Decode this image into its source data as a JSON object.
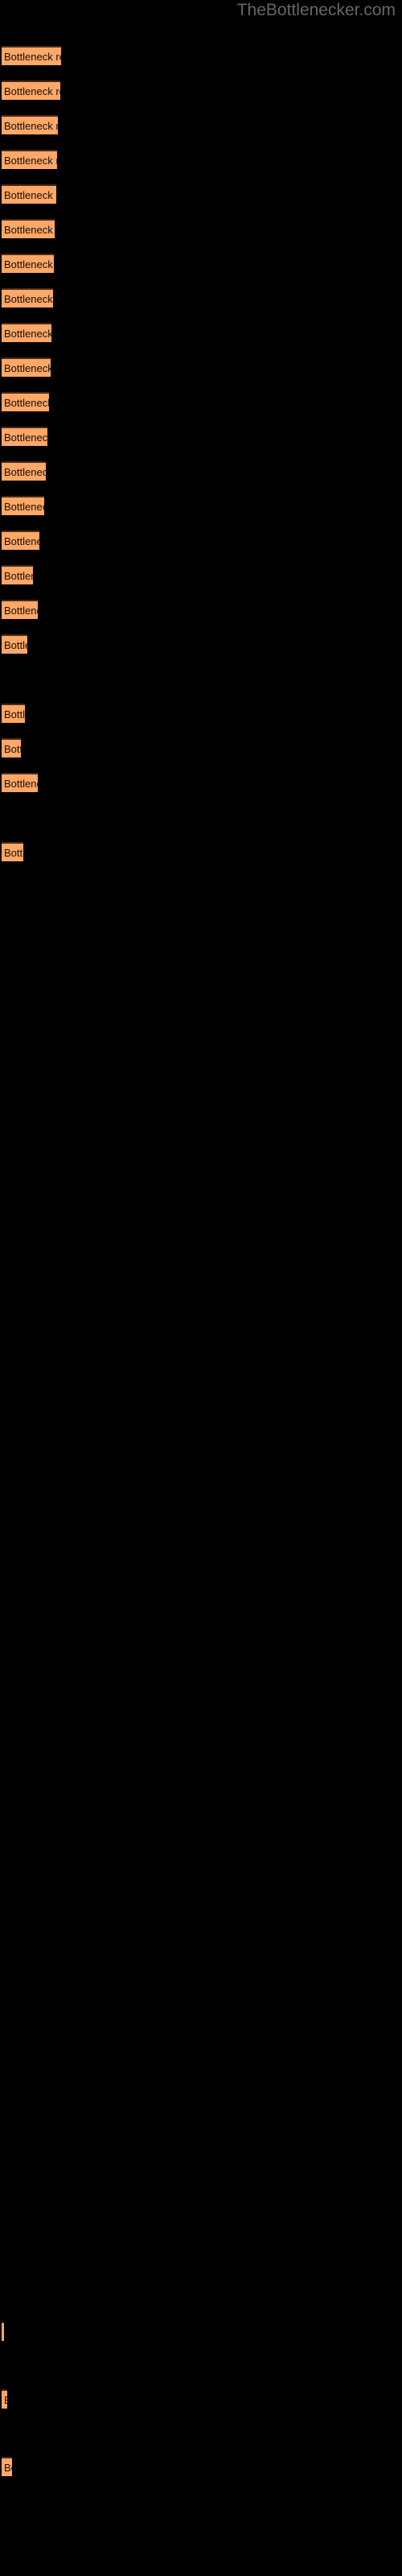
{
  "site": {
    "watermark": "TheBottlenecker.com"
  },
  "chart_data": {
    "type": "bar",
    "orientation": "horizontal",
    "title": "",
    "subtitle": "",
    "xlabel": "",
    "ylabel": "",
    "grid": false,
    "legend": null,
    "axis_visible": false,
    "background_color": "#000000",
    "bar_color": "#ffa766",
    "bar_border_color": "#4a2a16",
    "label_color": "#111111",
    "watermark_color": "#666666",
    "bar_label_text": "Bottleneck result",
    "xlim": [
      0,
      74
    ],
    "categories": [
      "bar-1",
      "bar-2",
      "bar-3",
      "bar-4",
      "bar-5",
      "bar-6",
      "bar-7",
      "bar-8",
      "bar-9",
      "bar-10",
      "bar-11",
      "bar-12",
      "bar-13",
      "bar-14",
      "bar-15",
      "bar-16",
      "bar-17",
      "bar-18",
      "bar-19",
      "bar-20",
      "bar-21",
      "bar-22",
      "bar-23",
      "bar-24",
      "bar-25",
      "bar-26",
      "bar-27",
      "bar-28",
      "bar-29",
      "bar-30",
      "bar-31",
      "bar-32",
      "bar-33",
      "bar-34",
      "bar-35"
    ],
    "values": [
      74,
      73,
      70,
      69,
      68,
      66,
      65,
      64,
      62,
      61,
      59,
      57,
      55,
      53,
      47,
      39,
      45,
      32,
      0,
      29,
      24,
      45,
      0,
      27,
      0,
      0,
      0,
      0,
      0,
      0,
      0,
      0,
      3,
      7,
      13
    ],
    "bars": [
      {
        "name": "bar-1",
        "y": 57,
        "width": 74,
        "label": "Bottleneck result"
      },
      {
        "name": "bar-2",
        "y": 100,
        "width": 73,
        "label": "Bottleneck result"
      },
      {
        "name": "bar-3",
        "y": 143,
        "width": 70,
        "label": "Bottleneck result"
      },
      {
        "name": "bar-4",
        "y": 186,
        "width": 69,
        "label": "Bottleneck result"
      },
      {
        "name": "bar-5",
        "y": 229,
        "width": 68,
        "label": "Bottleneck result"
      },
      {
        "name": "bar-6",
        "y": 272,
        "width": 66,
        "label": "Bottleneck result"
      },
      {
        "name": "bar-7",
        "y": 315,
        "width": 65,
        "label": "Bottleneck result"
      },
      {
        "name": "bar-8",
        "y": 358,
        "width": 64,
        "label": "Bottleneck result"
      },
      {
        "name": "bar-9",
        "y": 401,
        "width": 62,
        "label": "Bottleneck result"
      },
      {
        "name": "bar-10",
        "y": 444,
        "width": 61,
        "label": "Bottleneck result"
      },
      {
        "name": "bar-11",
        "y": 487,
        "width": 59,
        "label": "Bottleneck result"
      },
      {
        "name": "bar-12",
        "y": 530,
        "width": 57,
        "label": "Bottleneck result"
      },
      {
        "name": "bar-13",
        "y": 573,
        "width": 55,
        "label": "Bottleneck result"
      },
      {
        "name": "bar-14",
        "y": 616,
        "width": 53,
        "label": "Bottleneck result"
      },
      {
        "name": "bar-15",
        "y": 659,
        "width": 47,
        "label": "Bottleneck result"
      },
      {
        "name": "bar-16",
        "y": 702,
        "width": 39,
        "label": "Bottleneck result"
      },
      {
        "name": "bar-17",
        "y": 745,
        "width": 45,
        "label": "Bottleneck result"
      },
      {
        "name": "bar-18",
        "y": 788,
        "width": 32,
        "label": "Bottleneck result"
      },
      {
        "name": "bar-19",
        "y": 831,
        "width": 0,
        "label": "Bottleneck result"
      },
      {
        "name": "bar-20",
        "y": 874,
        "width": 29,
        "label": "Bottleneck result"
      },
      {
        "name": "bar-21",
        "y": 917,
        "width": 24,
        "label": "Bottleneck result"
      },
      {
        "name": "bar-22",
        "y": 960,
        "width": 45,
        "label": "Bottleneck result"
      },
      {
        "name": "bar-23",
        "y": 1003,
        "width": 0,
        "label": "Bottleneck result"
      },
      {
        "name": "bar-24",
        "y": 1046,
        "width": 27,
        "label": "Bottleneck result"
      },
      {
        "name": "bar-25",
        "y": 1089,
        "width": 0,
        "label": "Bottleneck result"
      },
      {
        "name": "bar-26",
        "y": 1132,
        "width": 0,
        "label": "Bottleneck result"
      },
      {
        "name": "bar-27",
        "y": 1175,
        "width": 0,
        "label": "Bottleneck result"
      },
      {
        "name": "bar-28",
        "y": 1218,
        "width": 0,
        "label": "Bottleneck result"
      },
      {
        "name": "bar-29",
        "y": 1261,
        "width": 0,
        "label": "Bottleneck result"
      },
      {
        "name": "bar-30",
        "y": 1304,
        "width": 0,
        "label": "Bottleneck result"
      },
      {
        "name": "bar-31",
        "y": 1347,
        "width": 0,
        "label": "Bottleneck result"
      },
      {
        "name": "bar-32",
        "y": 1390,
        "width": 0,
        "label": "Bottleneck result"
      },
      {
        "name": "bar-33",
        "y": 2884,
        "width": 3,
        "label": "Bottleneck result"
      },
      {
        "name": "bar-34",
        "y": 2968,
        "width": 7,
        "label": "Bottleneck result"
      },
      {
        "name": "bar-35",
        "y": 3052,
        "width": 13,
        "label": "Bottleneck result"
      }
    ]
  }
}
